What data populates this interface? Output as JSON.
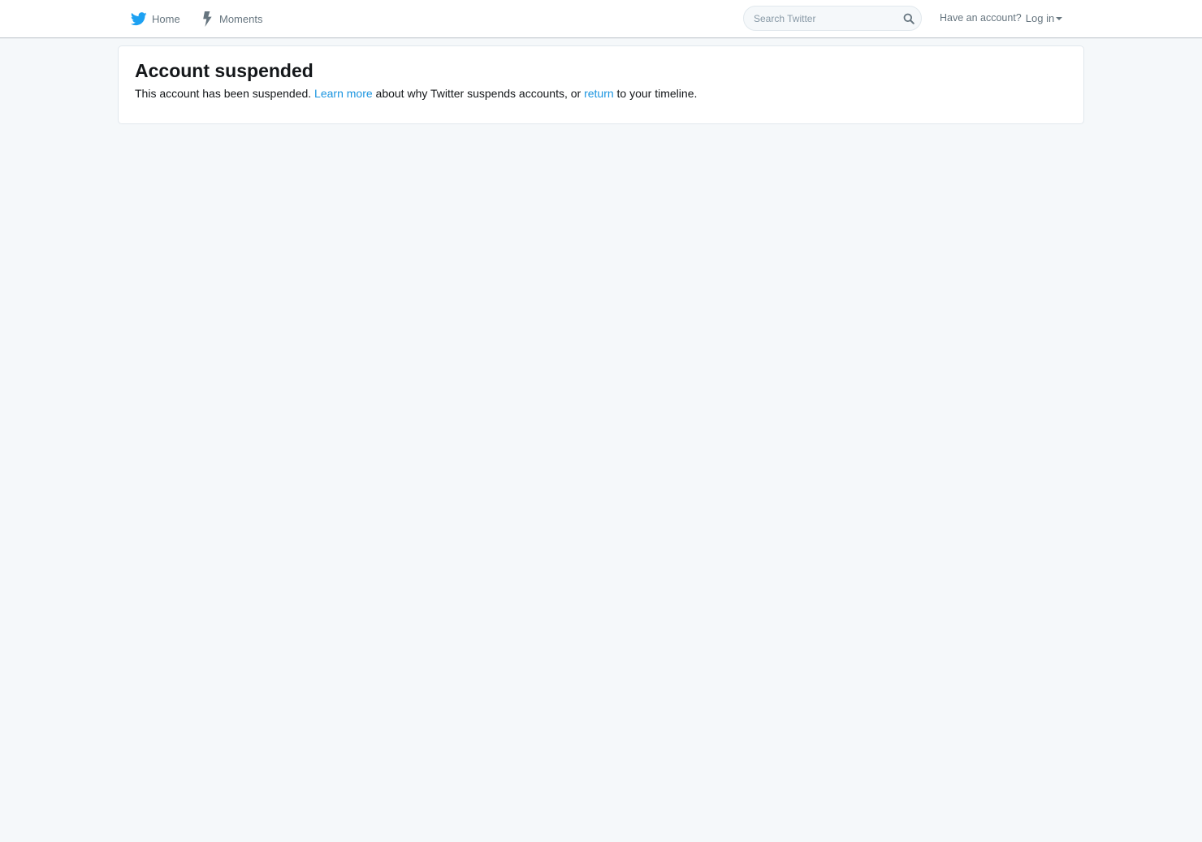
{
  "nav": {
    "home_label": "Home",
    "moments_label": "Moments"
  },
  "search": {
    "placeholder": "Search Twitter",
    "value": ""
  },
  "account": {
    "prompt": "Have an account?",
    "login_label": "Log in"
  },
  "notice": {
    "title": "Account suspended",
    "text_part1": "This account has been suspended.",
    "learn_more_link": "Learn more",
    "text_part2": "about why Twitter suspends accounts, or",
    "return_link": "return",
    "text_part3": "to your timeline."
  },
  "colors": {
    "brand_blue": "#1da1f2",
    "link_blue": "#1b95e0",
    "page_background": "#f5f8fa",
    "muted_text": "#66757f"
  },
  "icons": {
    "home": "twitter-bird-icon",
    "moments": "lightning-bolt-icon",
    "search": "magnifier-icon",
    "dropdown": "caret-down-icon"
  }
}
